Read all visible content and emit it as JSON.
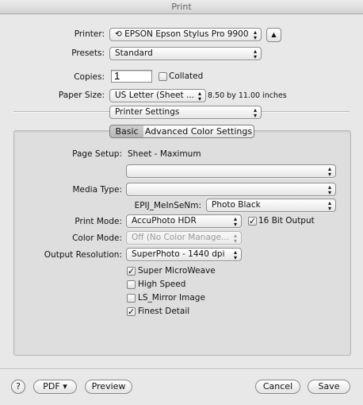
{
  "window": {
    "title": "Print"
  },
  "printer": {
    "label": "Printer:",
    "value": "EPSON Epson Stylus Pro 9900"
  },
  "presets": {
    "label": "Presets:",
    "value": "Standard"
  },
  "copies": {
    "label": "Copies:",
    "value": "1",
    "collated_label": "Collated",
    "collated": false
  },
  "paper": {
    "label": "Paper Size:",
    "value": "US Letter (Sheet ...",
    "dimensions": "8.50 by 11.00 inches"
  },
  "section_popup": {
    "value": "Printer Settings"
  },
  "tabs": {
    "basic": "Basic",
    "advanced": "Advanced Color Settings",
    "selected": "Basic"
  },
  "settings": {
    "page_setup_label": "Page Setup:",
    "page_setup_value": "Sheet - Maximum",
    "blank_popup_1": "",
    "media_type_label": "Media Type:",
    "media_type_value": "",
    "epij_label": "EPIJ_MeInSeNm:",
    "epij_value": "Photo Black",
    "print_mode_label": "Print Mode:",
    "print_mode_value": "AccuPhoto HDR",
    "bit16_label": "16 Bit Output",
    "color_mode_label": "Color Mode:",
    "color_mode_value": "Off (No Color Manage...",
    "output_res_label": "Output Resolution:",
    "output_res_value": "SuperPhoto - 1440 dpi"
  },
  "checkboxes": [
    {
      "label": "Super MicroWeave",
      "checked": true
    },
    {
      "label": "High Speed",
      "checked": false
    },
    {
      "label": "LS_Mirror Image",
      "checked": false
    },
    {
      "label": "Finest Detail",
      "checked": true
    }
  ],
  "footer": {
    "help": "?",
    "pdf": "PDF ▾",
    "preview": "Preview",
    "cancel": "Cancel",
    "save": "Save"
  },
  "icons": {
    "checkmark": "✓",
    "printer_glyph": "⟲",
    "up_arrow": "▲"
  }
}
